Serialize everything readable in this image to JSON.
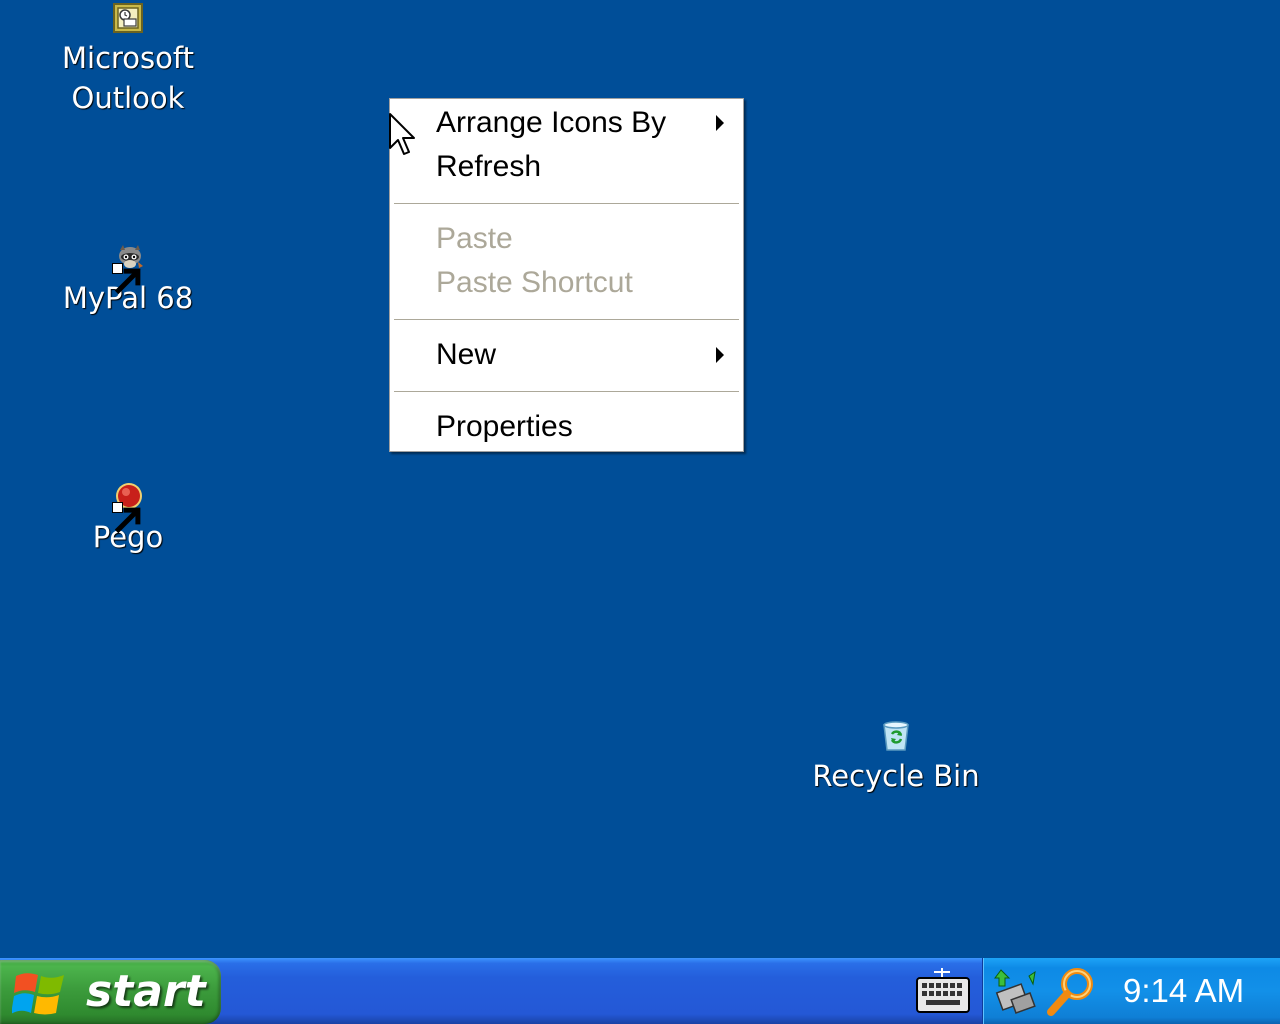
{
  "desktop": {
    "background_color": "#004e98",
    "icons": [
      {
        "label": "Microsoft\nOutlook",
        "icon": "outlook-icon"
      },
      {
        "label": "MyPal 68",
        "icon": "mypal-icon"
      },
      {
        "label": "Pego",
        "icon": "pego-icon"
      },
      {
        "label": "Recycle Bin",
        "icon": "recycle-bin-icon"
      }
    ]
  },
  "context_menu": {
    "items": [
      {
        "label": "Arrange Icons By",
        "submenu": true,
        "enabled": true
      },
      {
        "label": "Refresh",
        "submenu": false,
        "enabled": true
      },
      {
        "label": "Paste",
        "submenu": false,
        "enabled": false
      },
      {
        "label": "Paste Shortcut",
        "submenu": false,
        "enabled": false
      },
      {
        "label": "New",
        "submenu": true,
        "enabled": true
      },
      {
        "label": "Properties",
        "submenu": false,
        "enabled": true
      }
    ]
  },
  "taskbar": {
    "start_label": "start",
    "language_icon": "keyboard-icon",
    "tray_icons": [
      "network-icon",
      "search-icon"
    ],
    "clock": "9:14 AM"
  }
}
